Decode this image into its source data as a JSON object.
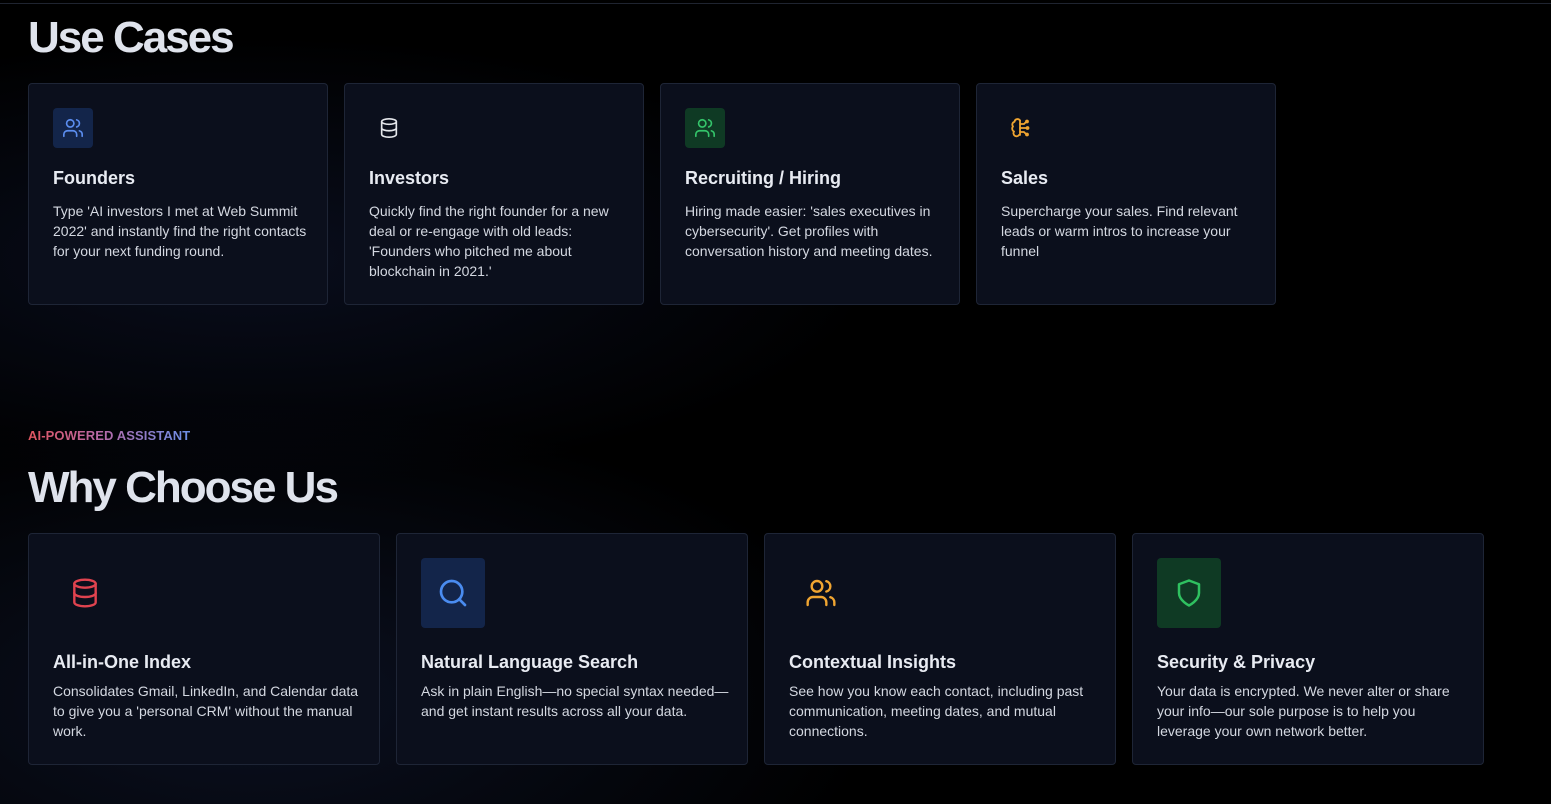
{
  "use_cases": {
    "title": "Use Cases",
    "cards": [
      {
        "title": "Founders",
        "description": "Type 'AI investors I met at Web Summit 2022' and instantly find the right contacts for your next funding round.",
        "icon": "users-icon",
        "icon_color": "#5b8def",
        "icon_bg": "#13254a"
      },
      {
        "title": "Investors",
        "description": "Quickly find the right founder for a new deal or re-engage with old leads: 'Founders who pitched me about blockchain in 2021.'",
        "icon": "database-icon",
        "icon_color": "#e5e7eb",
        "icon_bg": "transparent"
      },
      {
        "title": "Recruiting / Hiring",
        "description": "Hiring made easier: 'sales executives in cybersecurity'. Get profiles with conversation history and meeting dates.",
        "icon": "users-icon",
        "icon_color": "#34c46a",
        "icon_bg": "#0f3a24"
      },
      {
        "title": "Sales",
        "description": "Supercharge your sales. Find relevant leads or warm intros to increase your funnel",
        "icon": "brain-icon",
        "icon_color": "#f0a531",
        "icon_bg": "transparent"
      }
    ]
  },
  "why_choose_us": {
    "eyebrow": "AI-POWERED ASSISTANT",
    "title": "Why Choose Us",
    "cards": [
      {
        "title": "All-in-One Index",
        "description": "Consolidates Gmail, LinkedIn, and Calendar data to give you a 'personal CRM' without the manual work.",
        "icon": "database-icon",
        "icon_color": "#e0434f",
        "icon_bg": "transparent"
      },
      {
        "title": "Natural Language Search",
        "description": "Ask in plain English—no special syntax needed—and get instant results across all your data.",
        "icon": "search-icon",
        "icon_color": "#4a8cf0",
        "icon_bg": "#13254a"
      },
      {
        "title": "Contextual Insights",
        "description": "See how you know each contact, including past communication, meeting dates, and mutual connections.",
        "icon": "users-icon",
        "icon_color": "#f0a531",
        "icon_bg": "transparent"
      },
      {
        "title": "Security & Privacy",
        "description": "Your data is encrypted. We never alter or share your info—our sole purpose is to help you leverage your own network better.",
        "icon": "shield-icon",
        "icon_color": "#2fc160",
        "icon_bg": "#0f3a24"
      }
    ]
  }
}
